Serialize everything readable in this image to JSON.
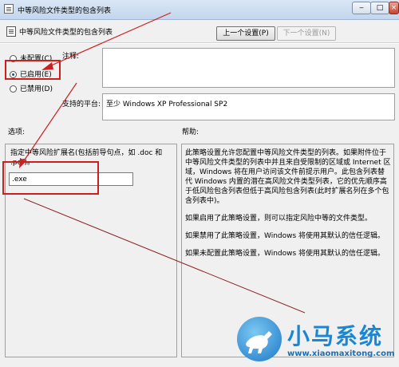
{
  "window": {
    "title": "中等风险文件类型的包含列表"
  },
  "header": {
    "title": "中等风险文件类型的包含列表",
    "prev_label": "上一个设置(P)",
    "next_label": "下一个设置(N)"
  },
  "radios": [
    {
      "label": "未配置(C)",
      "checked": false
    },
    {
      "label": "已启用(E)",
      "checked": true
    },
    {
      "label": "已禁用(D)",
      "checked": false
    }
  ],
  "comment_label": "注释:",
  "platform_label": "支持的平台:",
  "platform_value": "至少 Windows XP Professional SP2",
  "options_label": "选项:",
  "help_label": "帮助:",
  "options": {
    "description": "指定中等风险扩展名(包括前导句点，如 .doc 和 .pdf)。",
    "input_value": ".exe"
  },
  "help": {
    "paragraphs": [
      "此策略设置允许您配置中等风险文件类型的列表。如果附件位于中等风险文件类型的列表中并且来自受限制的区域或 Internet 区域，Windows 将在用户访问该文件前提示用户。此包含列表替代 Windows 内置的潜在高风险文件类型列表，它的优先顺序高于低风险包含列表但低于高风险包含列表(此时扩展名列在多个包含列表中)。",
      "如果启用了此策略设置，则可以指定风险中等的文件类型。",
      "如果禁用了此策略设置，Windows 将使用其默认的信任逻辑。",
      "如果未配置此策略设置，Windows 将使用其默认的信任逻辑。"
    ]
  },
  "annotation_color": "#cc1f1f",
  "watermark": {
    "title": "小马系统",
    "url": "www.xiaomaxitong.com"
  }
}
